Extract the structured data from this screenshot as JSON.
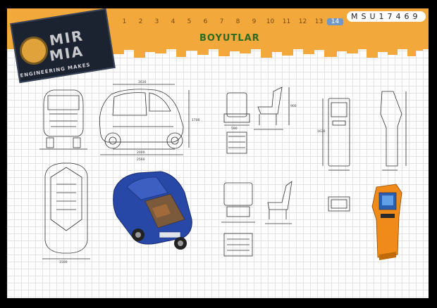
{
  "logo": {
    "line1": "MIR",
    "line2": "MIA",
    "subtitle": "ENGINEERING MAKES"
  },
  "nav": {
    "pages": [
      "1",
      "2",
      "3",
      "4",
      "5",
      "6",
      "7",
      "8",
      "9",
      "10",
      "11",
      "12",
      "13",
      "14"
    ],
    "active": "14"
  },
  "code": "MSU17469",
  "title": "BOYUTLAR",
  "dimensions": {
    "car_length": "2560",
    "car_height": "1700",
    "car_top": "1630",
    "car_wheelbase": "2000",
    "car_width": "1500",
    "seat_w": "590",
    "seat_h": "900",
    "kiosk_h": "1630"
  },
  "colors": {
    "banner": "#f2a83a",
    "car_body": "#2848a8",
    "kiosk": "#f08a18",
    "title": "#2e6b22"
  }
}
